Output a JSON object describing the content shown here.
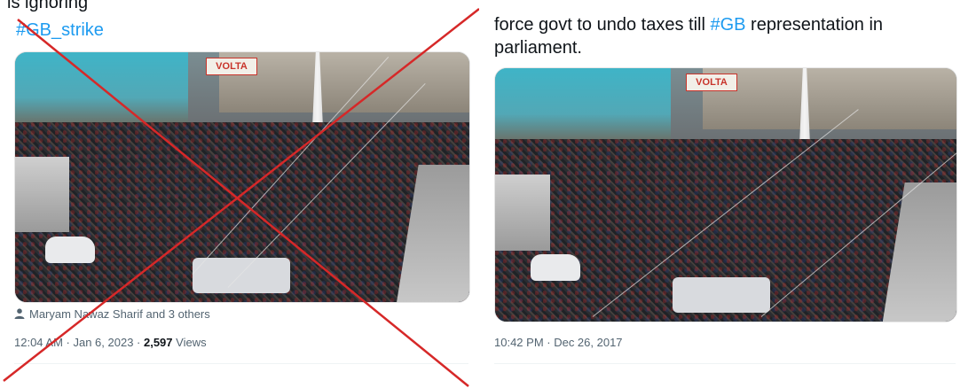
{
  "left_tweet": {
    "partial_text": "is ignoring",
    "hashtag": "#GB_strike",
    "photo_sign": "VOLTA",
    "tagged_people": "Maryam Nawaz Sharif and 3 others",
    "timestamp": "12:04 AM · Jan 6, 2023 · ",
    "views_count": "2,597",
    "views_label": " Views",
    "fake_marker": "red-x-cross",
    "marker_color": "#d62828"
  },
  "right_tweet": {
    "text_prefix": "force govt to undo taxes till ",
    "hashtag": "#GB",
    "text_suffix": " representation in",
    "text_line2": "parliament.",
    "photo_sign": "VOLTA",
    "timestamp": "10:42 PM · Dec 26, 2017"
  },
  "colors": {
    "hashtag": "#1d9bf0",
    "text": "#0f1419",
    "meta": "#536471"
  }
}
